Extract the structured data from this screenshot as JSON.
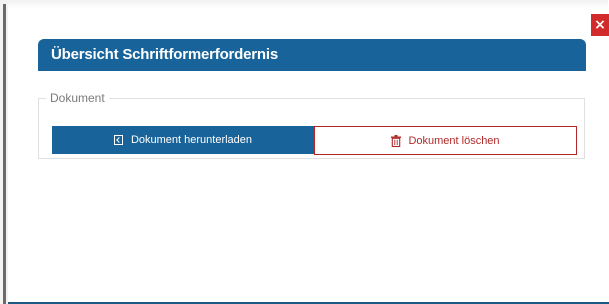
{
  "dialog": {
    "title": "Übersicht Schriftformerfordernis",
    "close_label": "×"
  },
  "document_section": {
    "legend": "Dokument",
    "download_label": "Dokument herunterladen",
    "delete_label": "Dokument löschen"
  },
  "icons": {
    "close": "close-icon",
    "download": "download-icon",
    "delete": "trash-icon"
  },
  "colors": {
    "primary": "#17639a",
    "danger": "#b02a2a",
    "close": "#d22b2b"
  }
}
